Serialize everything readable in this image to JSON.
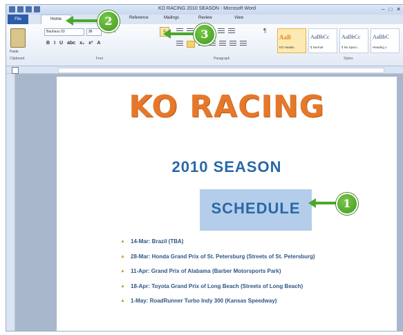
{
  "app": {
    "title": "KO RACING 2010 SEASON - Microsoft Word",
    "window_controls": [
      "–",
      "□",
      "✕"
    ]
  },
  "tabs": [
    "File",
    "Home",
    "Reference",
    "Mailings",
    "Review",
    "View"
  ],
  "ribbon": {
    "paste_label": "Paste",
    "clipboard_label": "Clipboard",
    "font_name": "Bauhaus 93",
    "font_size": "26",
    "grow_shrink": "A A",
    "format_buttons": [
      "B",
      "I",
      "U",
      "abc",
      "x₂",
      "x²",
      "A"
    ],
    "clear_format": "A",
    "font_group_label": "Font",
    "paragraph_group_label": "Paragraph",
    "pilcrow": "¶",
    "styles_group_label": "Styles",
    "styles": [
      {
        "sample": "AaB",
        "name": "KO Heade..."
      },
      {
        "sample": "AaBbCc",
        "name": "¶ Normal"
      },
      {
        "sample": "AaBbCc",
        "name": "¶ No Spaci..."
      },
      {
        "sample": "AaBbC",
        "name": "Heading 1"
      }
    ]
  },
  "document": {
    "title": "KO RACING",
    "season": "2010 SEASON",
    "schedule": "SCHEDULE",
    "items": [
      "14-Mar: Brazil (TBA)",
      "28-Mar: Honda Grand Prix of St. Petersburg (Streets of St. Petersburg)",
      "11-Apr: Grand Prix of Alabama (Barber Motorsports Park)",
      "18-Apr: Toyota Grand Prix of Long Beach (Streets of Long Beach)",
      "1-May: RoadRunner Turbo Indy 300 (Kansas Speedway)"
    ]
  },
  "callouts": {
    "one": "1",
    "two": "2",
    "three": "3"
  },
  "colors": {
    "title_orange": "#e5782a",
    "heading_blue": "#2a67a8",
    "highlight": "#b4cdea",
    "callout_green": "#4aa82a"
  }
}
